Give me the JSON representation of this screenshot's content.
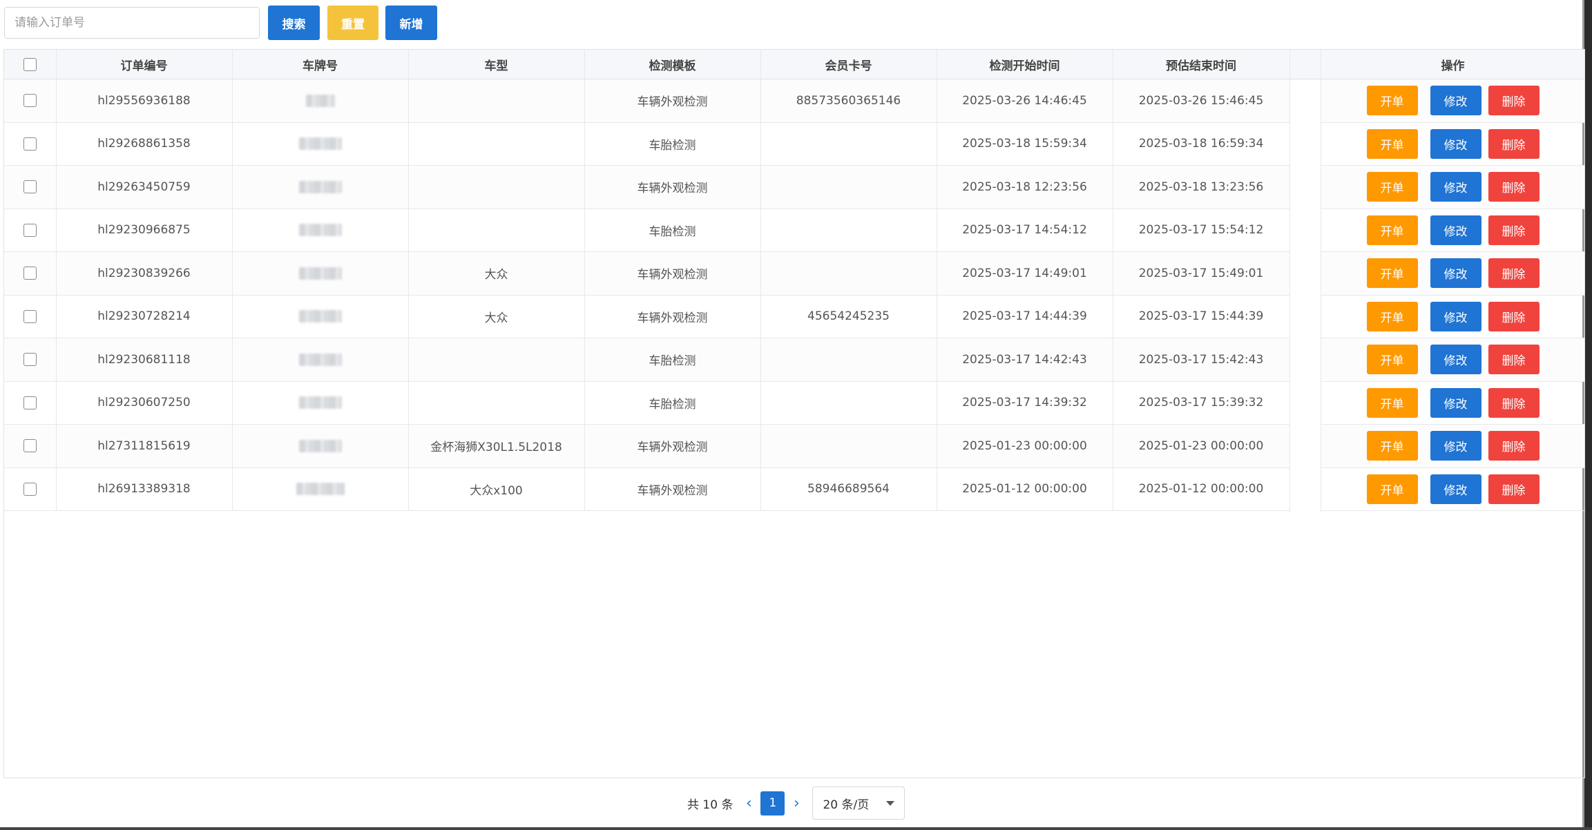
{
  "toolbar": {
    "search_placeholder": "请输入订单号",
    "search_label": "搜索",
    "reset_label": "重置",
    "add_label": "新增"
  },
  "table": {
    "headers": {
      "order_no": "订单编号",
      "plate": "车牌号",
      "model": "车型",
      "template": "检测模板",
      "member_card": "会员卡号",
      "start_time": "检测开始时间",
      "end_time": "预估结束时间",
      "actions": "操作"
    },
    "rows": [
      {
        "order_no": "hl29556936188",
        "plate": "",
        "model": "",
        "template": "车辆外观检测",
        "member_card": "88573560365146",
        "start_time": "2025-03-26 14:46:45",
        "end_time": "2025-03-26 15:46:45"
      },
      {
        "order_no": "hl29268861358",
        "plate": "",
        "model": "",
        "template": "车胎检测",
        "member_card": "",
        "start_time": "2025-03-18 15:59:34",
        "end_time": "2025-03-18 16:59:34"
      },
      {
        "order_no": "hl29263450759",
        "plate": "",
        "model": "",
        "template": "车辆外观检测",
        "member_card": "",
        "start_time": "2025-03-18 12:23:56",
        "end_time": "2025-03-18 13:23:56"
      },
      {
        "order_no": "hl29230966875",
        "plate": "",
        "model": "",
        "template": "车胎检测",
        "member_card": "",
        "start_time": "2025-03-17 14:54:12",
        "end_time": "2025-03-17 15:54:12"
      },
      {
        "order_no": "hl29230839266",
        "plate": "",
        "model": "大众",
        "template": "车辆外观检测",
        "member_card": "",
        "start_time": "2025-03-17 14:49:01",
        "end_time": "2025-03-17 15:49:01"
      },
      {
        "order_no": "hl29230728214",
        "plate": "",
        "model": "大众",
        "template": "车辆外观检测",
        "member_card": "45654245235",
        "start_time": "2025-03-17 14:44:39",
        "end_time": "2025-03-17 15:44:39"
      },
      {
        "order_no": "hl29230681118",
        "plate": "",
        "model": "",
        "template": "车胎检测",
        "member_card": "",
        "start_time": "2025-03-17 14:42:43",
        "end_time": "2025-03-17 15:42:43"
      },
      {
        "order_no": "hl29230607250",
        "plate": "",
        "model": "",
        "template": "车胎检测",
        "member_card": "",
        "start_time": "2025-03-17 14:39:32",
        "end_time": "2025-03-17 15:39:32"
      },
      {
        "order_no": "hl27311815619",
        "plate": "",
        "model": "金杯海狮X30L1.5L2018",
        "template": "车辆外观检测",
        "member_card": "",
        "start_time": "2025-01-23 00:00:00",
        "end_time": "2025-01-23 00:00:00"
      },
      {
        "order_no": "hl26913389318",
        "plate": "",
        "model": "大众x100",
        "template": "车辆外观检测",
        "member_card": "58946689564",
        "start_time": "2025-01-12 00:00:00",
        "end_time": "2025-01-12 00:00:00"
      }
    ],
    "row_actions": {
      "open": "开单",
      "edit": "修改",
      "delete": "删除"
    }
  },
  "pagination": {
    "total_text": "共 10 条",
    "current_page": "1",
    "page_size": "20 条/页"
  },
  "colors": {
    "primary": "#1f74d4",
    "warning": "#f5c33b",
    "orange": "#ff9900",
    "danger": "#f0433d"
  }
}
